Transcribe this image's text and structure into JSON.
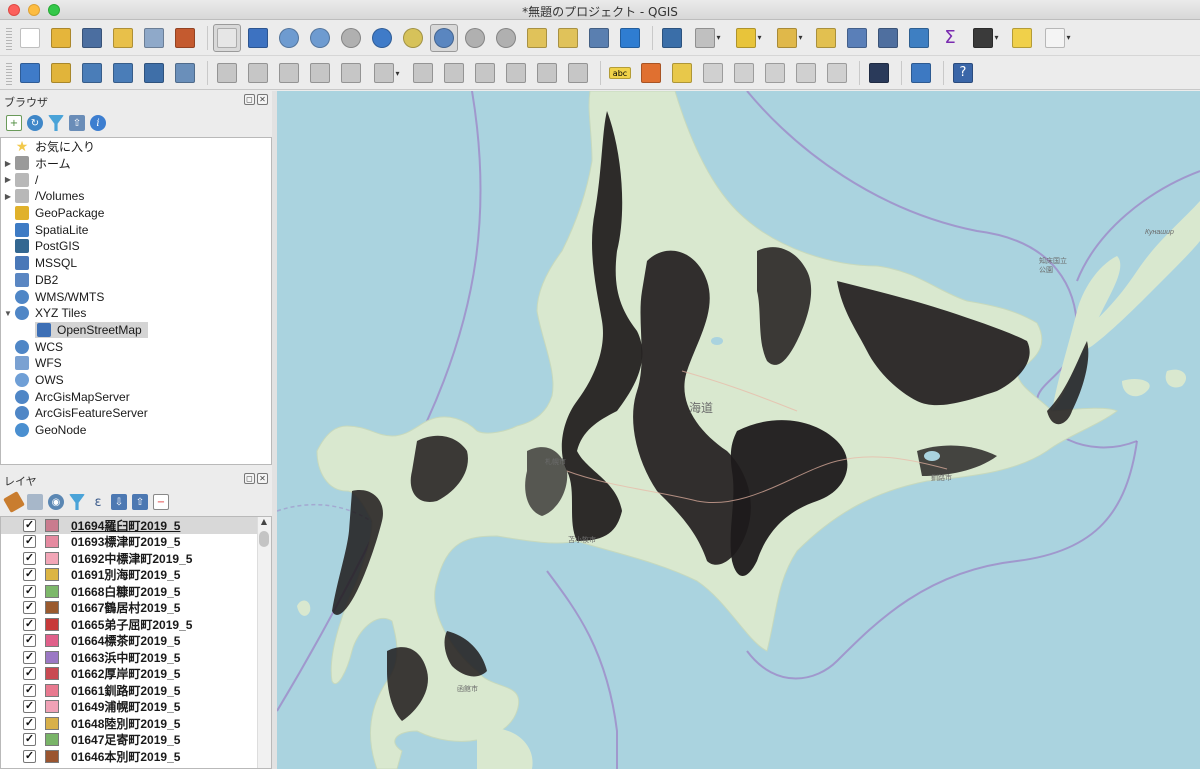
{
  "window": {
    "title": "*無題のプロジェクト - QGIS"
  },
  "toolbar_top": {
    "icons": [
      "new-project-icon",
      "open-project-icon",
      "save-project-icon",
      "save-as-icon",
      "print-layout-icon",
      "style-manager-icon",
      "pan-icon",
      "pan-to-selection-icon",
      "zoom-in-icon",
      "zoom-out-icon",
      "zoom-native-icon",
      "zoom-full-icon",
      "zoom-to-selection-icon",
      "zoom-to-layer-icon",
      "zoom-last-icon",
      "zoom-next-icon",
      "new-bookmark-icon",
      "show-bookmarks-icon",
      "new-map-view-icon",
      "refresh-icon",
      "identify-icon",
      "run-action-icon",
      "select-features-icon",
      "select-by-value-icon",
      "deselect-icon",
      "attribute-table-icon",
      "field-calculator-icon",
      "toolbox-icon",
      "statistics-icon",
      "measure-icon",
      "map-tips-icon",
      "text-annotation-icon"
    ]
  },
  "toolbar_bottom": {
    "icons": [
      "data-source-manager-icon",
      "new-geopackage-icon",
      "new-shapefile-icon",
      "new-spatialite-icon",
      "new-virtual-layer-icon",
      "new-temporary-layer-icon",
      "digitize-pencil-icon",
      "edit-toggle-icon",
      "save-edits-icon",
      "add-polygon-icon",
      "vertex-tool-icon",
      "modify-attributes-icon",
      "delete-selected-icon",
      "cut-features-icon",
      "copy-features-icon",
      "paste-features-icon",
      "undo-icon",
      "redo-icon",
      "label-tool-abc-icon",
      "diagram-icon",
      "highlight-labels-icon",
      "pin-label-icon",
      "show-hide-labels-icon",
      "move-label-icon",
      "rotate-label-icon",
      "change-label-icon",
      "gps-car-icon",
      "python-icon",
      "help-icon"
    ],
    "abc_text": "abc",
    "help_text": "?"
  },
  "browser": {
    "title": "ブラウザ",
    "items": [
      {
        "label": "お気に入り",
        "icon": "star-icon",
        "arrow": "",
        "color": "#f2c94c"
      },
      {
        "label": "ホーム",
        "icon": "home-folder-icon",
        "arrow": "▶",
        "color": "#9a9a9a"
      },
      {
        "label": "/",
        "icon": "folder-icon",
        "arrow": "▶",
        "color": "#b8b8b8"
      },
      {
        "label": "/Volumes",
        "icon": "folder-icon",
        "arrow": "▶",
        "color": "#b8b8b8"
      },
      {
        "label": "GeoPackage",
        "icon": "geopackage-icon",
        "arrow": "",
        "color": "#e0b12b"
      },
      {
        "label": "SpatiaLite",
        "icon": "spatialite-icon",
        "arrow": "",
        "color": "#3e7bc4"
      },
      {
        "label": "PostGIS",
        "icon": "postgis-elephant-icon",
        "arrow": "",
        "color": "#336791"
      },
      {
        "label": "MSSQL",
        "icon": "mssql-icon",
        "arrow": "",
        "color": "#4a78b8"
      },
      {
        "label": "DB2",
        "icon": "db2-icon",
        "arrow": "",
        "color": "#5a86c2"
      },
      {
        "label": "WMS/WMTS",
        "icon": "globe-icon",
        "arrow": "",
        "color": "#4f86c6"
      },
      {
        "label": "XYZ Tiles",
        "icon": "globe-icon",
        "arrow": "▼",
        "color": "#4f86c6"
      },
      {
        "label": "OpenStreetMap",
        "icon": "xyz-tiles-icon",
        "arrow": "",
        "color": "#3d6fb5",
        "child": true,
        "selected": true
      },
      {
        "label": "WCS",
        "icon": "globe-icon",
        "arrow": "",
        "color": "#4f86c6"
      },
      {
        "label": "WFS",
        "icon": "wfs-icon",
        "arrow": "",
        "color": "#7aa1d2"
      },
      {
        "label": "OWS",
        "icon": "globe-icon",
        "arrow": "",
        "color": "#6f9fd6"
      },
      {
        "label": "ArcGisMapServer",
        "icon": "globe-icon",
        "arrow": "",
        "color": "#4f86c6"
      },
      {
        "label": "ArcGisFeatureServer",
        "icon": "globe-icon",
        "arrow": "",
        "color": "#4f86c6"
      },
      {
        "label": "GeoNode",
        "icon": "geonode-icon",
        "arrow": "",
        "color": "#4a8fd0"
      }
    ]
  },
  "layers": {
    "title": "レイヤ",
    "items": [
      {
        "label": "01694羅臼町2019_5",
        "color": "#c97b8e",
        "checked": true
      },
      {
        "label": "01693標津町2019_5",
        "color": "#e58aa0",
        "checked": true
      },
      {
        "label": "01692中標津町2019_5",
        "color": "#f2a6b7",
        "checked": true
      },
      {
        "label": "01691別海町2019_5",
        "color": "#dcb544",
        "checked": true
      },
      {
        "label": "01668白糠町2019_5",
        "color": "#7db86a",
        "checked": true
      },
      {
        "label": "01667鶴居村2019_5",
        "color": "#9a5a2e",
        "checked": true
      },
      {
        "label": "01665弟子屈町2019_5",
        "color": "#c73a3a",
        "checked": true
      },
      {
        "label": "01664標茶町2019_5",
        "color": "#e0608a",
        "checked": true
      },
      {
        "label": "01663浜中町2019_5",
        "color": "#9b78c4",
        "checked": true
      },
      {
        "label": "01662厚岸町2019_5",
        "color": "#c94a52",
        "checked": true
      },
      {
        "label": "01661釧路町2019_5",
        "color": "#e8798f",
        "checked": true
      },
      {
        "label": "01649浦幌町2019_5",
        "color": "#f0a2b6",
        "checked": true
      },
      {
        "label": "01648陸別町2019_5",
        "color": "#d8b04a",
        "checked": true
      },
      {
        "label": "01647足寄町2019_5",
        "color": "#79b468",
        "checked": true
      },
      {
        "label": "01646本別町2019_5",
        "color": "#9a5530",
        "checked": true
      }
    ]
  },
  "map": {
    "labels": {
      "hokkaido": "海道",
      "kushiro": "釧路市",
      "tomakomai": "苫小牧市",
      "sapporo": "札幌市",
      "hakodate": "函館市",
      "shiretoko": "知床国立公園",
      "kunashir": "Кунашир"
    },
    "colors": {
      "sea": "#aad3df",
      "land": "#d9e8cf",
      "forest": "#1e1a1b",
      "boundary": "#9b7fc4"
    }
  }
}
